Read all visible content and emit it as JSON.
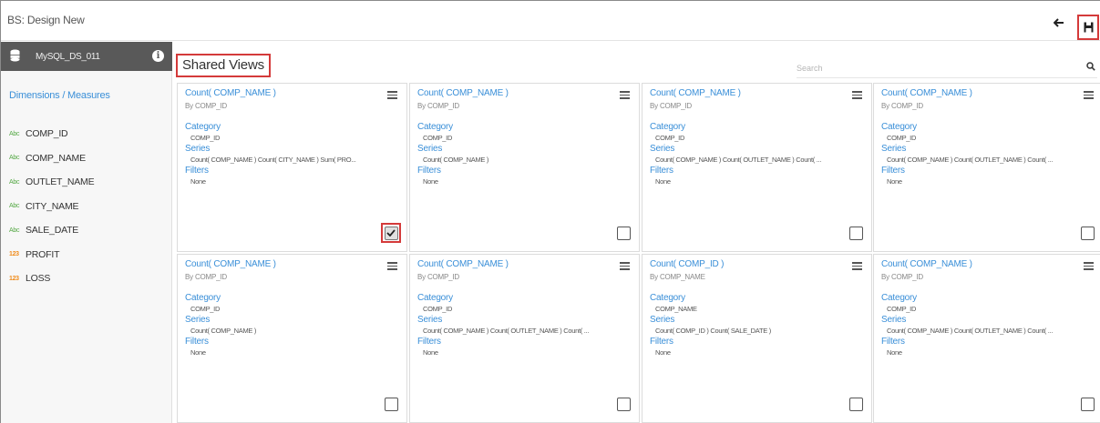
{
  "app_title": "BS: Design New",
  "header": {
    "back_icon": "arrow-left-icon",
    "save_icon": "save-icon"
  },
  "sidebar": {
    "datasource": {
      "name": "MySQL_DS_011",
      "info_icon": "info-icon"
    },
    "dimensions_measures_label": "Dimensions / Measures",
    "fields": [
      {
        "type": "Abc",
        "name": "COMP_ID"
      },
      {
        "type": "Abc",
        "name": "COMP_NAME"
      },
      {
        "type": "Abc",
        "name": "OUTLET_NAME"
      },
      {
        "type": "Abc",
        "name": "CITY_NAME"
      },
      {
        "type": "Abc",
        "name": "SALE_DATE"
      },
      {
        "type": "123",
        "name": "PROFIT"
      },
      {
        "type": "123",
        "name": "LOSS"
      }
    ],
    "colors": {
      "abc": "#55a845",
      "num": "#f08c1c"
    }
  },
  "main": {
    "title": "Shared Views",
    "search": {
      "placeholder": "Search",
      "value": ""
    },
    "labels": {
      "category": "Category",
      "series": "Series",
      "filters": "Filters"
    },
    "views": [
      {
        "title": "Count( COMP_NAME )",
        "by": "By COMP_ID",
        "category": "COMP_ID",
        "series": "Count( COMP_NAME ) Count( CITY_NAME ) Sum( PRO...",
        "filters": "None",
        "checked": true
      },
      {
        "title": "Count( COMP_NAME )",
        "by": "By COMP_ID",
        "category": "COMP_ID",
        "series": "Count( COMP_NAME )",
        "filters": "None",
        "checked": false
      },
      {
        "title": "Count( COMP_NAME )",
        "by": "By COMP_ID",
        "category": "COMP_ID",
        "series": "Count( COMP_NAME ) Count( OUTLET_NAME ) Count( ...",
        "filters": "None",
        "checked": false
      },
      {
        "title": "Count( COMP_NAME )",
        "by": "By COMP_ID",
        "category": "COMP_ID",
        "series": "Count( COMP_NAME ) Count( OUTLET_NAME ) Count( ...",
        "filters": "None",
        "checked": false
      },
      {
        "title": "Count( COMP_NAME )",
        "by": "By COMP_ID",
        "category": "COMP_ID",
        "series": "Count( COMP_NAME )",
        "filters": "None",
        "checked": false
      },
      {
        "title": "Count( COMP_NAME )",
        "by": "By COMP_ID",
        "category": "COMP_ID",
        "series": "Count( COMP_NAME ) Count( OUTLET_NAME ) Count( ...",
        "filters": "None",
        "checked": false
      },
      {
        "title": "Count( COMP_ID )",
        "by": "By COMP_NAME",
        "category": "COMP_NAME",
        "series": "Count( COMP_ID ) Count( SALE_DATE )",
        "filters": "None",
        "checked": false
      },
      {
        "title": "Count( COMP_NAME )",
        "by": "By COMP_ID",
        "category": "COMP_ID",
        "series": "Count( COMP_NAME ) Count( OUTLET_NAME ) Count( ...",
        "filters": "None",
        "checked": false
      }
    ],
    "highlight_color": "#d43a3a",
    "accent_color": "#3a8fd8"
  }
}
